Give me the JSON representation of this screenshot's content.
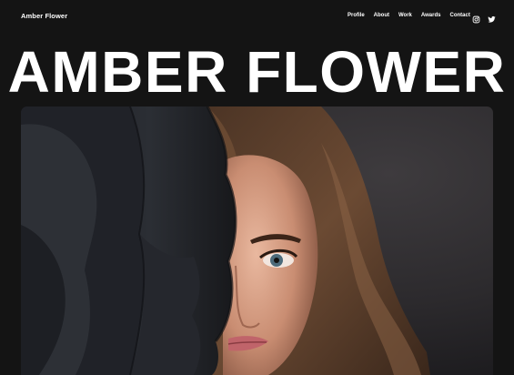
{
  "brand": {
    "name": "Amber Flower"
  },
  "nav": {
    "items": [
      "Profile",
      "About",
      "Work",
      "Awards",
      "Contact"
    ]
  },
  "social": {
    "icons": [
      "instagram-icon",
      "twitter-icon"
    ]
  },
  "hero": {
    "title": "AMBER FLOWER"
  },
  "colors": {
    "background": "#141414",
    "text": "#ffffff"
  }
}
